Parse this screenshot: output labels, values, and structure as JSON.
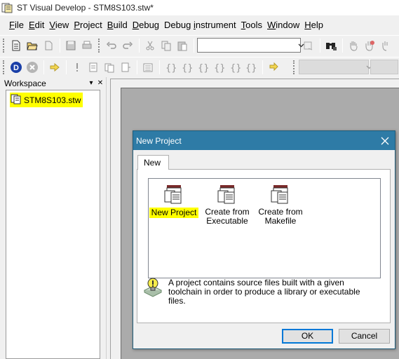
{
  "window": {
    "title": "ST Visual Develop - STM8S103.stw*"
  },
  "menu": [
    {
      "u": "F",
      "rest": "ile"
    },
    {
      "u": "E",
      "rest": "dit"
    },
    {
      "u": "V",
      "rest": "iew"
    },
    {
      "u": "P",
      "rest": "roject"
    },
    {
      "u": "B",
      "rest": "uild"
    },
    {
      "u": "D",
      "rest": "ebug"
    },
    {
      "pre": "Debug ",
      "u": "i",
      "rest": "nstrument"
    },
    {
      "u": "T",
      "rest": "ools"
    },
    {
      "u": "W",
      "rest": "indow"
    },
    {
      "u": "H",
      "rest": "elp"
    }
  ],
  "workspace": {
    "title": "Workspace",
    "item": "STM8S103.stw"
  },
  "dialog": {
    "title": "New Project",
    "tab": "New",
    "items": [
      {
        "label": "New Project"
      },
      {
        "label": "Create from\nExecutable"
      },
      {
        "label": "Create from\nMakefile"
      }
    ],
    "description": "A project contains source files built with a given toolchain in order to produce a library or executable files.",
    "ok": "OK",
    "cancel": "Cancel"
  },
  "colors": {
    "highlight": "#ffff00",
    "dialog_title": "#2e7ba6",
    "mdi_bg": "#ababab"
  }
}
